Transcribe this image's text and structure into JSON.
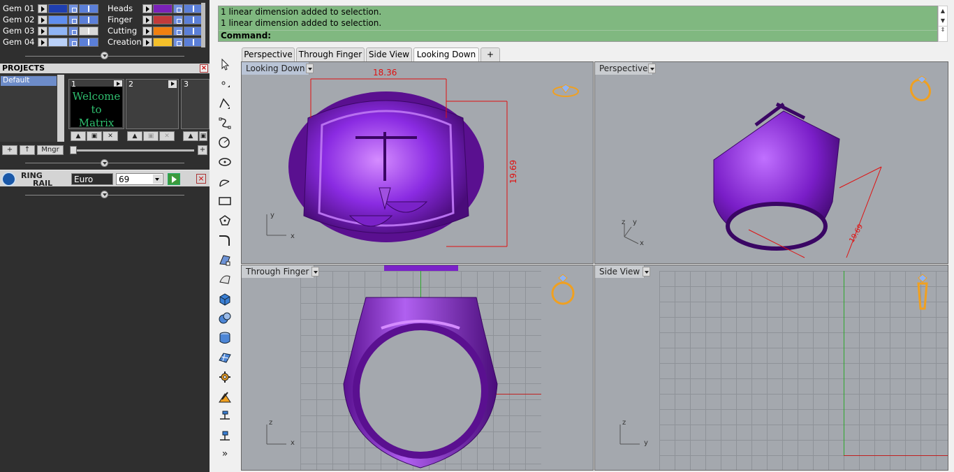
{
  "layers": {
    "left": [
      {
        "label": "Gem 01",
        "color": "#1f3fb0"
      },
      {
        "label": "Gem 02",
        "color": "#5f8ef0"
      },
      {
        "label": "Gem 03",
        "color": "#8fb4f5"
      },
      {
        "label": "Gem 04",
        "color": "#b9d0f8"
      }
    ],
    "right": [
      {
        "label": "Heads",
        "color": "#7a22b8"
      },
      {
        "label": "Finger",
        "color": "#c23b3b"
      },
      {
        "label": "Cutting",
        "color": "#f08010"
      },
      {
        "label": "Creation",
        "color": "#f5c02a"
      }
    ]
  },
  "projects": {
    "header": "PROJECTS",
    "close": "×",
    "list": [
      "Default"
    ],
    "thumbs": [
      "1",
      "2",
      "3"
    ],
    "welcome_line1": "Welcome to",
    "welcome_line2": "Matrix",
    "mngr_label": "Mngr",
    "add_label": "+",
    "up_label": "↑",
    "plus_label": "+"
  },
  "ring_rail": {
    "label_line1": "RING",
    "label_line2": "RAIL",
    "unit": "Euro",
    "size": "69",
    "close": "×"
  },
  "command": {
    "history": [
      "1 linear dimension added to selection.",
      "1 linear dimension added to selection."
    ],
    "prompt": "Command:"
  },
  "tabs": [
    "Perspective",
    "Through Finger",
    "Side View",
    "Looking Down",
    "+"
  ],
  "active_tab": "Looking Down",
  "viewports": {
    "looking_down": {
      "title": "Looking Down",
      "dim_h": "18.36",
      "dim_v": "19.69",
      "axis1": "y",
      "axis2": "x"
    },
    "perspective": {
      "title": "Perspective",
      "dim": "19.69",
      "axis1": "z",
      "axis2": "y",
      "axis3": "x"
    },
    "through_finger": {
      "title": "Through Finger",
      "axis1": "z",
      "axis2": "x"
    },
    "side_view": {
      "title": "Side View",
      "axis1": "z",
      "axis2": "y"
    }
  },
  "toolbar_more": "»",
  "colors": {
    "metal": "#8a2be2",
    "command_bg": "#80b880",
    "dimension": "#e01010",
    "gold_icon": "#f0a020"
  }
}
